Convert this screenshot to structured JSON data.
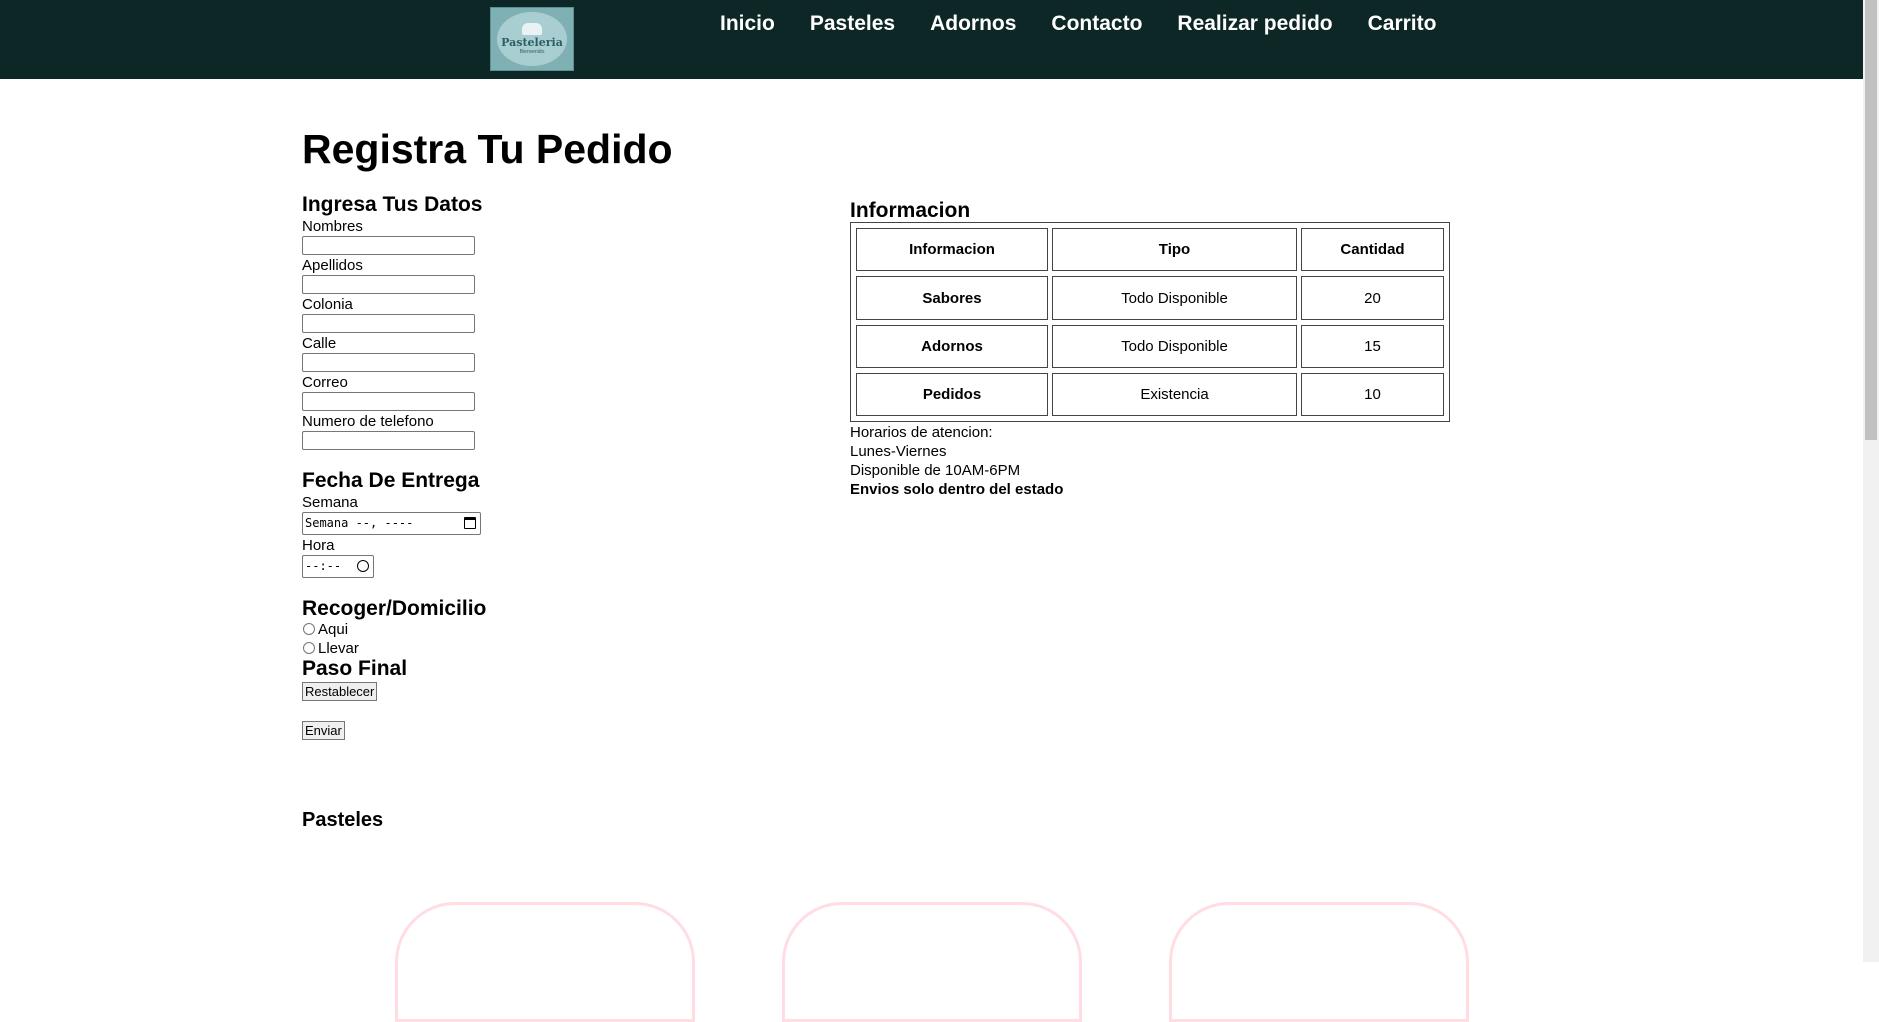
{
  "nav": {
    "logo_text": "Pasteleria",
    "logo_subtext": "Bienvenido",
    "items": [
      "Inicio",
      "Pasteles",
      "Adornos",
      "Contacto",
      "Realizar pedido",
      "Carrito"
    ]
  },
  "page_title": "Registra Tu Pedido",
  "datos": {
    "heading": "Ingresa Tus Datos",
    "fields": [
      "Nombres",
      "Apellidos",
      "Colonia",
      "Calle",
      "Correo",
      "Numero de telefono"
    ]
  },
  "fecha": {
    "heading": "Fecha De Entrega",
    "semana_label": "Semana",
    "semana_placeholder": "Semana --, ----",
    "hora_label": "Hora",
    "hora_placeholder": "--:--"
  },
  "recoger": {
    "heading": "Recoger/Domicilio",
    "options": [
      "Aqui",
      "Llevar"
    ]
  },
  "paso_final": {
    "heading": "Paso Final",
    "reset_label": "Restablecer",
    "submit_label": "Enviar"
  },
  "informacion": {
    "heading": "Informacion",
    "columns": [
      "Informacion",
      "Tipo",
      "Cantidad"
    ],
    "rows": [
      [
        "Sabores",
        "Todo Disponible",
        "20"
      ],
      [
        "Adornos",
        "Todo Disponible",
        "15"
      ],
      [
        "Pedidos",
        "Existencia",
        "10"
      ]
    ],
    "lines": [
      "Horarios de atencion:",
      "Lunes-Viernes",
      "Disponible de 10AM-6PM"
    ],
    "bold_line": "Envios solo dentro del estado"
  },
  "pasteles_heading": "Pasteles",
  "colors": {
    "navbar": "#0d2626",
    "card_border": "#ffdde3"
  }
}
